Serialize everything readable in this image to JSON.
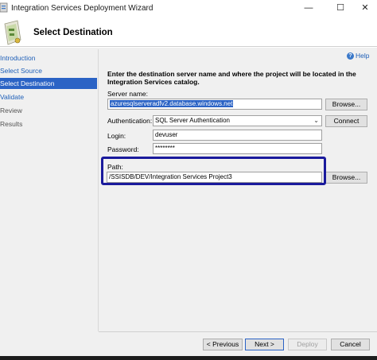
{
  "window": {
    "title": "Integration Services Deployment Wizard",
    "minimize": "—",
    "maximize": "☐",
    "close": "✕"
  },
  "header": {
    "title": "Select Destination"
  },
  "sidebar": {
    "items": [
      {
        "label": "Introduction",
        "state": "link"
      },
      {
        "label": "Select Source",
        "state": "link"
      },
      {
        "label": "Select Destination",
        "state": "active"
      },
      {
        "label": "Validate",
        "state": "link"
      },
      {
        "label": "Review",
        "state": "disabled"
      },
      {
        "label": "Results",
        "state": "disabled"
      }
    ]
  },
  "help": {
    "label": "Help",
    "icon": "help-icon"
  },
  "form": {
    "instruction": "Enter the destination server name and where the project will be located in the Integration Services catalog.",
    "server_name_label": "Server name:",
    "server_name_value": "azuresqlserveradfv2.database.windows.net",
    "browse_server": "Browse...",
    "authentication_label": "Authentication:",
    "authentication_value": "SQL Server Authentication",
    "connect": "Connect",
    "login_label": "Login:",
    "login_value": "devuser",
    "password_label": "Password:",
    "password_value": "********",
    "path_label": "Path:",
    "path_value": "/SSISDB/DEV/Integration Services Project3",
    "browse_path": "Browse..."
  },
  "footer": {
    "previous": "< Previous",
    "next": "Next >",
    "deploy": "Deploy",
    "cancel": "Cancel"
  },
  "colors": {
    "accent": "#2b63c5",
    "link": "#1e5fb8",
    "highlight_border": "#1a1a9c",
    "panel_bg": "#f0f0f0"
  }
}
